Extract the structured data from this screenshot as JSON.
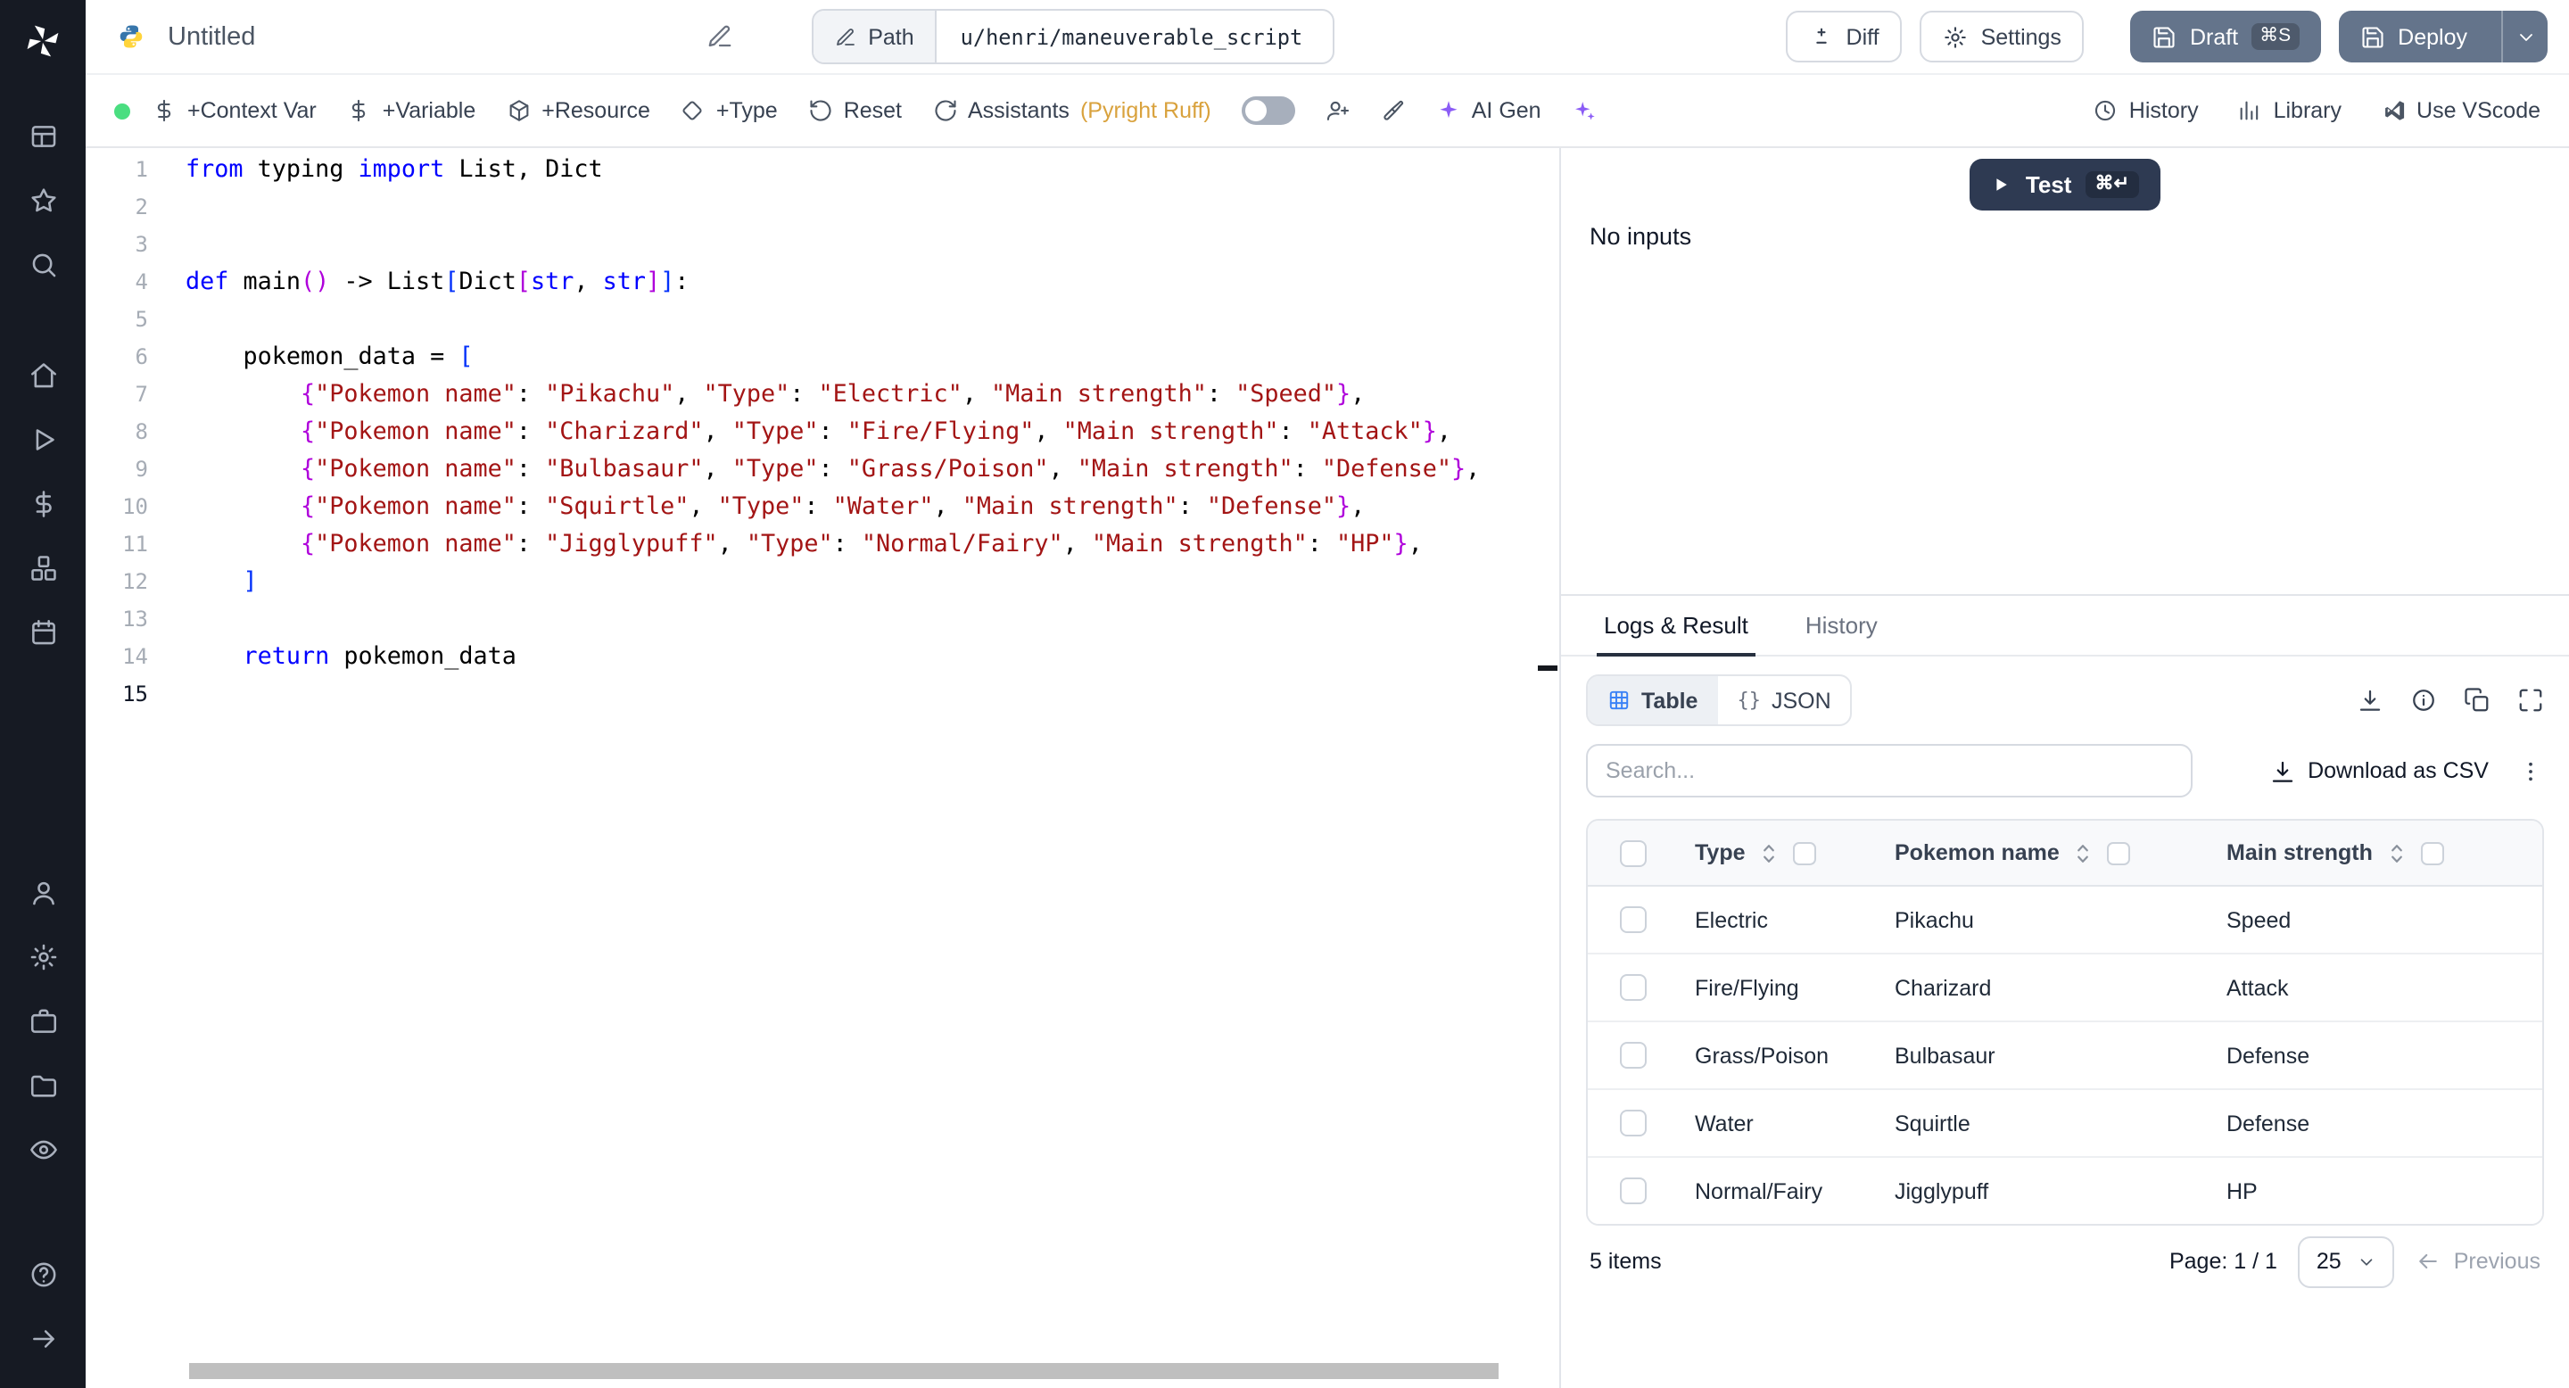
{
  "colors": {
    "sidebar-bg": "#161a23",
    "slate": "#64748b",
    "navy": "#2e3a52",
    "green": "#4ade80",
    "amber": "#d9a23d",
    "violet": "#8b5cf6",
    "blue": "#3b82f6",
    "kw": "#0000ff",
    "st": "#a31515",
    "b1": "#0431fa",
    "b2": "#af00db"
  },
  "topbar": {
    "title": "Untitled",
    "path_label": "Path",
    "path_value": "u/henri/maneuverable_script",
    "diff_label": "Diff",
    "settings_label": "Settings",
    "draft_label": "Draft",
    "draft_shortcut": "⌘S",
    "deploy_label": "Deploy"
  },
  "toolbar": {
    "context_var": "+Context Var",
    "variable": "+Variable",
    "resource": "+Resource",
    "type": "+Type",
    "reset": "Reset",
    "assistants": "Assistants",
    "assistants_detail": "(Pyright Ruff)",
    "ai_gen": "AI Gen",
    "history": "History",
    "library": "Library",
    "use_vscode": "Use VScode"
  },
  "editor": {
    "language": "python",
    "active_line": 15,
    "lines": [
      [
        {
          "c": "kw",
          "t": "from"
        },
        {
          "c": "pl",
          "t": " typing "
        },
        {
          "c": "kw",
          "t": "import"
        },
        {
          "c": "pl",
          "t": " List, Dict"
        }
      ],
      [],
      [],
      [
        {
          "c": "kw",
          "t": "def"
        },
        {
          "c": "pl",
          "t": " main"
        },
        {
          "c": "b2",
          "t": "()"
        },
        {
          "c": "pl",
          "t": " -> List"
        },
        {
          "c": "b1",
          "t": "["
        },
        {
          "c": "pl",
          "t": "Dict"
        },
        {
          "c": "b2",
          "t": "["
        },
        {
          "c": "kw",
          "t": "str"
        },
        {
          "c": "pl",
          "t": ", "
        },
        {
          "c": "kw",
          "t": "str"
        },
        {
          "c": "b2",
          "t": "]"
        },
        {
          "c": "b1",
          "t": "]"
        },
        {
          "c": "pl",
          "t": ":"
        }
      ],
      [],
      [
        {
          "c": "pl",
          "t": "    pokemon_data = "
        },
        {
          "c": "b1",
          "t": "["
        }
      ],
      [
        {
          "c": "pl",
          "t": "        "
        },
        {
          "c": "b2",
          "t": "{"
        },
        {
          "c": "st",
          "t": "\"Pokemon name\""
        },
        {
          "c": "pl",
          "t": ": "
        },
        {
          "c": "st",
          "t": "\"Pikachu\""
        },
        {
          "c": "pl",
          "t": ", "
        },
        {
          "c": "st",
          "t": "\"Type\""
        },
        {
          "c": "pl",
          "t": ": "
        },
        {
          "c": "st",
          "t": "\"Electric\""
        },
        {
          "c": "pl",
          "t": ", "
        },
        {
          "c": "st",
          "t": "\"Main strength\""
        },
        {
          "c": "pl",
          "t": ": "
        },
        {
          "c": "st",
          "t": "\"Speed\""
        },
        {
          "c": "b2",
          "t": "}"
        },
        {
          "c": "pl",
          "t": ","
        }
      ],
      [
        {
          "c": "pl",
          "t": "        "
        },
        {
          "c": "b2",
          "t": "{"
        },
        {
          "c": "st",
          "t": "\"Pokemon name\""
        },
        {
          "c": "pl",
          "t": ": "
        },
        {
          "c": "st",
          "t": "\"Charizard\""
        },
        {
          "c": "pl",
          "t": ", "
        },
        {
          "c": "st",
          "t": "\"Type\""
        },
        {
          "c": "pl",
          "t": ": "
        },
        {
          "c": "st",
          "t": "\"Fire/Flying\""
        },
        {
          "c": "pl",
          "t": ", "
        },
        {
          "c": "st",
          "t": "\"Main strength\""
        },
        {
          "c": "pl",
          "t": ": "
        },
        {
          "c": "st",
          "t": "\"Attack\""
        },
        {
          "c": "b2",
          "t": "}"
        },
        {
          "c": "pl",
          "t": ","
        }
      ],
      [
        {
          "c": "pl",
          "t": "        "
        },
        {
          "c": "b2",
          "t": "{"
        },
        {
          "c": "st",
          "t": "\"Pokemon name\""
        },
        {
          "c": "pl",
          "t": ": "
        },
        {
          "c": "st",
          "t": "\"Bulbasaur\""
        },
        {
          "c": "pl",
          "t": ", "
        },
        {
          "c": "st",
          "t": "\"Type\""
        },
        {
          "c": "pl",
          "t": ": "
        },
        {
          "c": "st",
          "t": "\"Grass/Poison\""
        },
        {
          "c": "pl",
          "t": ", "
        },
        {
          "c": "st",
          "t": "\"Main strength\""
        },
        {
          "c": "pl",
          "t": ": "
        },
        {
          "c": "st",
          "t": "\"Defense\""
        },
        {
          "c": "b2",
          "t": "}"
        },
        {
          "c": "pl",
          "t": ","
        }
      ],
      [
        {
          "c": "pl",
          "t": "        "
        },
        {
          "c": "b2",
          "t": "{"
        },
        {
          "c": "st",
          "t": "\"Pokemon name\""
        },
        {
          "c": "pl",
          "t": ": "
        },
        {
          "c": "st",
          "t": "\"Squirtle\""
        },
        {
          "c": "pl",
          "t": ", "
        },
        {
          "c": "st",
          "t": "\"Type\""
        },
        {
          "c": "pl",
          "t": ": "
        },
        {
          "c": "st",
          "t": "\"Water\""
        },
        {
          "c": "pl",
          "t": ", "
        },
        {
          "c": "st",
          "t": "\"Main strength\""
        },
        {
          "c": "pl",
          "t": ": "
        },
        {
          "c": "st",
          "t": "\"Defense\""
        },
        {
          "c": "b2",
          "t": "}"
        },
        {
          "c": "pl",
          "t": ","
        }
      ],
      [
        {
          "c": "pl",
          "t": "        "
        },
        {
          "c": "b2",
          "t": "{"
        },
        {
          "c": "st",
          "t": "\"Pokemon name\""
        },
        {
          "c": "pl",
          "t": ": "
        },
        {
          "c": "st",
          "t": "\"Jigglypuff\""
        },
        {
          "c": "pl",
          "t": ", "
        },
        {
          "c": "st",
          "t": "\"Type\""
        },
        {
          "c": "pl",
          "t": ": "
        },
        {
          "c": "st",
          "t": "\"Normal/Fairy\""
        },
        {
          "c": "pl",
          "t": ", "
        },
        {
          "c": "st",
          "t": "\"Main strength\""
        },
        {
          "c": "pl",
          "t": ": "
        },
        {
          "c": "st",
          "t": "\"HP\""
        },
        {
          "c": "b2",
          "t": "}"
        },
        {
          "c": "pl",
          "t": ","
        }
      ],
      [
        {
          "c": "pl",
          "t": "    "
        },
        {
          "c": "b1",
          "t": "]"
        }
      ],
      [],
      [
        {
          "c": "pl",
          "t": "    "
        },
        {
          "c": "kw",
          "t": "return"
        },
        {
          "c": "pl",
          "t": " pokemon_data"
        }
      ],
      []
    ]
  },
  "run_panel": {
    "test_label": "Test",
    "test_shortcut": "⌘↵",
    "no_inputs": "No inputs"
  },
  "results": {
    "tabs": [
      {
        "label": "Logs & Result"
      },
      {
        "label": "History"
      }
    ],
    "view_toggle": {
      "table_label": "Table",
      "json_braces": "{}",
      "json_label": "JSON"
    },
    "search_placeholder": "Search...",
    "download_csv": "Download as CSV",
    "footer": {
      "items": "5 items",
      "page": "Page: 1 / 1",
      "page_size": "25",
      "previous": "Previous"
    }
  },
  "result_table": {
    "columns": [
      "Type",
      "Pokemon name",
      "Main strength"
    ],
    "rows": [
      [
        "Electric",
        "Pikachu",
        "Speed"
      ],
      [
        "Fire/Flying",
        "Charizard",
        "Attack"
      ],
      [
        "Grass/Poison",
        "Bulbasaur",
        "Defense"
      ],
      [
        "Water",
        "Squirtle",
        "Defense"
      ],
      [
        "Normal/Fairy",
        "Jigglypuff",
        "HP"
      ]
    ]
  }
}
